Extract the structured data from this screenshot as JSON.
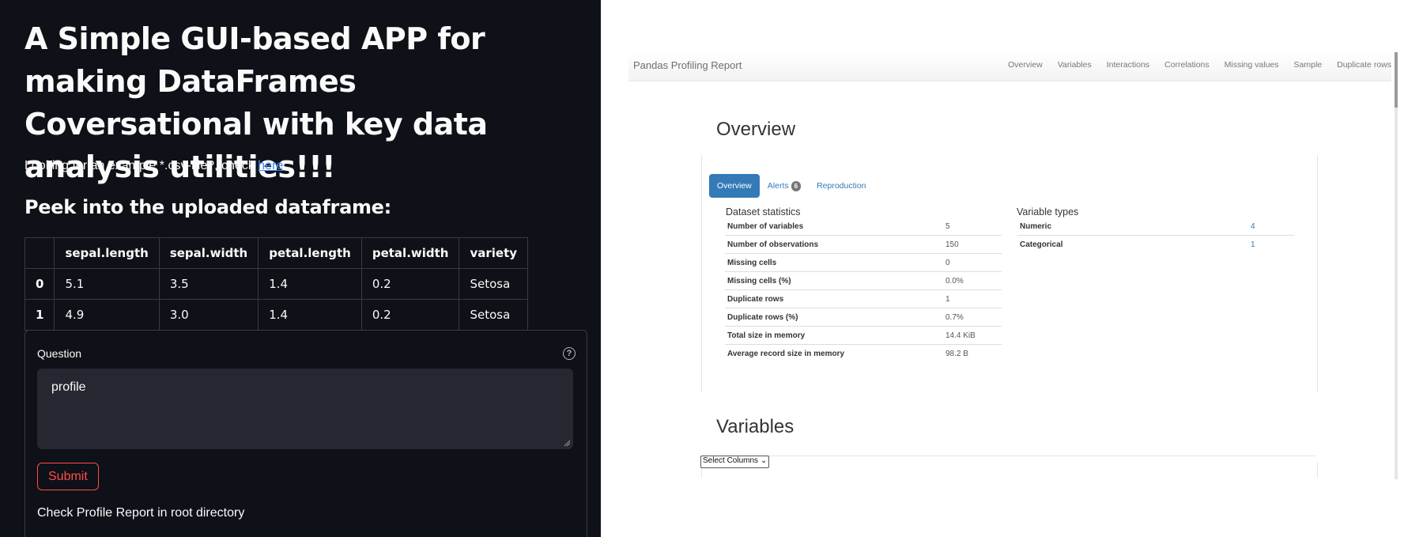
{
  "app": {
    "title": "A Simple GUI-based APP for making DataFrames Coversational with key data analysis utilities!!!",
    "example_prefix": "Looking for an example *.csv-file?, check ",
    "example_link": "here",
    "example_suffix": ".",
    "peek_heading": "Peek into the uploaded dataframe:",
    "table": {
      "columns": [
        "",
        "sepal.length",
        "sepal.width",
        "petal.length",
        "petal.width",
        "variety"
      ],
      "rows": [
        [
          "0",
          "5.1",
          "3.5",
          "1.4",
          "0.2",
          "Setosa"
        ],
        [
          "1",
          "4.9",
          "3.0",
          "1.4",
          "0.2",
          "Setosa"
        ]
      ]
    },
    "form": {
      "question_label": "Question",
      "help_icon_glyph": "?",
      "question_value": "profile",
      "submit_label": "Submit",
      "status_text": "Check Profile Report in root directory"
    }
  },
  "report": {
    "brand": "Pandas Profiling Report",
    "nav": [
      "Overview",
      "Variables",
      "Interactions",
      "Correlations",
      "Missing values",
      "Sample",
      "Duplicate rows"
    ],
    "overview_title": "Overview",
    "tabs": {
      "overview": "Overview",
      "alerts": "Alerts",
      "alerts_count": "6",
      "reproduction": "Reproduction"
    },
    "dataset_statistics": {
      "title": "Dataset statistics",
      "rows": [
        [
          "Number of variables",
          "5"
        ],
        [
          "Number of observations",
          "150"
        ],
        [
          "Missing cells",
          "0"
        ],
        [
          "Missing cells (%)",
          "0.0%"
        ],
        [
          "Duplicate rows",
          "1"
        ],
        [
          "Duplicate rows (%)",
          "0.7%"
        ],
        [
          "Total size in memory",
          "14.4 KiB"
        ],
        [
          "Average record size in memory",
          "98.2 B"
        ]
      ]
    },
    "variable_types": {
      "title": "Variable types",
      "rows": [
        [
          "Numeric",
          "4"
        ],
        [
          "Categorical",
          "1"
        ]
      ]
    },
    "variables_title": "Variables",
    "select_columns": "Select Columns"
  },
  "colors": {
    "app_bg": "#0e1117",
    "submit_accent": "#ff4b4b",
    "link": "#3d8bff",
    "report_primary": "#337ab7"
  }
}
